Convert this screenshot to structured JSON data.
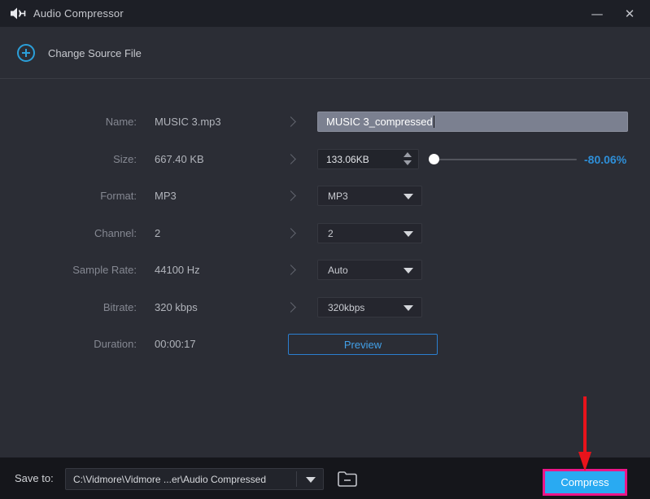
{
  "window": {
    "title": "Audio Compressor",
    "controls": {
      "minimize": "—",
      "close": "✕"
    }
  },
  "source": {
    "change_button_label": "Change Source File",
    "plus_icon": "circle-plus"
  },
  "form": {
    "rows": [
      {
        "label": "Name:",
        "value": "MUSIC 3.mp3"
      },
      {
        "label": "Size:",
        "value": "667.40 KB"
      },
      {
        "label": "Format:",
        "value": "MP3"
      },
      {
        "label": "Channel:",
        "value": "2"
      },
      {
        "label": "Sample Rate:",
        "value": "44100 Hz"
      },
      {
        "label": "Bitrate:",
        "value": "320 kbps"
      },
      {
        "label": "Duration:",
        "value": "00:00:17"
      }
    ],
    "name_input_value": "MUSIC 3_compressed",
    "size_spinner_value": "133.06KB",
    "size_percent": "-80.06%",
    "format_select": "MP3",
    "channel_select": "2",
    "sample_rate_select": "Auto",
    "bitrate_select": "320kbps",
    "preview_button_label": "Preview"
  },
  "footer": {
    "save_to_label": "Save to:",
    "save_path": "C:\\Vidmore\\Vidmore ...er\\Audio Compressed",
    "compress_button_label": "Compress"
  },
  "colors": {
    "accent_blue": "#2b9fd9",
    "percent_blue": "#2e8fd8",
    "compress_blue": "#29aaf2",
    "highlight_pink": "#ec1688",
    "annotation_red": "#e8131b",
    "titlebar_bg": "#1d1f26",
    "main_bg": "#2b2d35",
    "footer_bg": "#15161b"
  }
}
